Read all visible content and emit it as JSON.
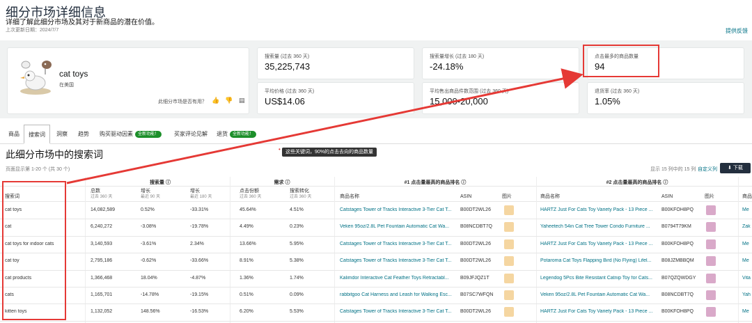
{
  "header": {
    "title": "细分市场详细信息",
    "subtitle": "详细了解此细分市场及其对于新商品的潜在价值。",
    "updated": "上次更新日期：2024/7/7",
    "feedback": "提供反馈"
  },
  "product": {
    "name": "cat toys",
    "market": "在美国",
    "helpful_question": "此细分市场是否有用？"
  },
  "metrics": [
    {
      "label": "搜索量 (过去 360 天)",
      "value": "35,225,743"
    },
    {
      "label": "搜索量增长 (过去 180 天)",
      "value": "-24.18%"
    },
    {
      "label": "点击最多的商品数量",
      "value": "94"
    },
    {
      "label": "平均价格 (过去 360 天)",
      "value": "US$14.06"
    },
    {
      "label": "平均售出商品件数范围 (过去 360 天)",
      "value": "15,000-20,000"
    },
    {
      "label": "退货率 (过去 360 天)",
      "value": "1.05%"
    }
  ],
  "tabs": {
    "products": "商品",
    "search_terms": "搜索词",
    "insights": "洞察",
    "trends": "趋势",
    "purchase_drivers": "购买驱动因素",
    "badge1": "全新功能！",
    "buyer_reviews": "买家评论见解",
    "returns": "退货",
    "badge2": "全新功能！"
  },
  "section": {
    "title": "此细分市场中的搜索词",
    "tooltip": "这些关键词，90%的点击去向的商品数量",
    "showing": "页面显示第 1-20 个 (共 30 个)",
    "display": "显示 15 列中的 15 列",
    "custom": "自定义列",
    "download": "下载"
  },
  "table_headers": {
    "search_volume": "搜索量",
    "demand": "需求",
    "top1": "#1 点击量最高的商品排名",
    "top2": "#2 点击量最高的商品排名",
    "search_term": "搜索词",
    "total": "总数",
    "total_sub": "过去 360 天",
    "growth90": "增长",
    "growth90_sub": "最近 90 天",
    "growth180": "增长",
    "growth180_sub": "最近 180 天",
    "click_share": "点击份额",
    "click_share_sub": "过去 360 天",
    "conversion": "搜索转化",
    "conversion_sub": "过去 360 天",
    "product_name": "商品名称",
    "asin": "ASIN",
    "image": "图片",
    "product_name2": "商品名称",
    "asin2": "ASIN",
    "image2": "图片",
    "more": "商品"
  },
  "rows": [
    {
      "term": "cat toys",
      "total": "14,082,589",
      "g90": "0.52%",
      "g180": "-33.31%",
      "click": "45.64%",
      "conv": "4.51%",
      "p1": "Catstages Tower of Tracks Interactive 3-Tier Cat T...",
      "a1": "B00DT2WL26",
      "p2": "HARTZ Just For Cats Toy Variety Pack - 13 Piece ...",
      "a2": "B00KFOH8PQ",
      "more": "Me"
    },
    {
      "term": "cat",
      "total": "6,240,272",
      "g90": "-3.08%",
      "g180": "-19.78%",
      "click": "4.49%",
      "conv": "0.23%",
      "p1": "Veken 95oz/2.8L Pet Fountain Automatic Cat Wa...",
      "a1": "B08NCDBT7Q",
      "p2": "Yaheetech 54in Cat Tree Tower Condo Furniture ...",
      "a2": "B0794T79KM",
      "more": "Zak"
    },
    {
      "term": "cat toys for indoor cats",
      "total": "3,140,593",
      "g90": "-3.61%",
      "g180": "2.34%",
      "click": "13.66%",
      "conv": "5.95%",
      "p1": "Catstages Tower of Tracks Interactive 3-Tier Cat T...",
      "a1": "B00DT2WL26",
      "p2": "HARTZ Just For Cats Toy Variety Pack - 13 Piece ...",
      "a2": "B00KFOH8PQ",
      "more": "Me"
    },
    {
      "term": "cat toy",
      "total": "2,795,186",
      "g90": "-0.62%",
      "g180": "-33.66%",
      "click": "8.91%",
      "conv": "5.38%",
      "p1": "Catstages Tower of Tracks Interactive 3-Tier Cat T...",
      "a1": "B00DT2WL26",
      "p2": "Potaroma Cat Toys Flapping Bird (No Flying) Lifel...",
      "a2": "B08JZMBBQM",
      "more": "Me"
    },
    {
      "term": "cat products",
      "total": "1,366,468",
      "g90": "18.04%",
      "g180": "-4.87%",
      "click": "1.36%",
      "conv": "1.74%",
      "p1": "Kalimdor Interactive Cat Feather Toys Retractabl...",
      "a1": "B09JFJQZ1T",
      "p2": "Legendog 5Pcs Bite Resistant Catnip Toy for Cats...",
      "a2": "B07QZQWDGY",
      "more": "Vita"
    },
    {
      "term": "cats",
      "total": "1,165,701",
      "g90": "-14.78%",
      "g180": "-19.15%",
      "click": "0.51%",
      "conv": "0.09%",
      "p1": "rabbitgoo Cat Harness and Leash for Walking Esc...",
      "a1": "B07SC7WFQN",
      "p2": "Veken 95oz/2.8L Pet Fountain Automatic Cat Wa...",
      "a2": "B08NCDBT7Q",
      "more": "Yah"
    },
    {
      "term": "kitten toys",
      "total": "1,132,052",
      "g90": "148.56%",
      "g180": "-16.53%",
      "click": "6.20%",
      "conv": "5.53%",
      "p1": "Catstages Tower of Tracks Interactive 3-Tier Cat T...",
      "a1": "B00DT2WL26",
      "p2": "HARTZ Just For Cats Toy Variety Pack - 13 Piece ...",
      "a2": "B00KFOH8PQ",
      "more": "Me"
    }
  ],
  "colors": {
    "accent_link": "#007185",
    "annotation_red": "#e53935",
    "badge_green": "#1c8f2a",
    "dark": "#232f3e"
  }
}
